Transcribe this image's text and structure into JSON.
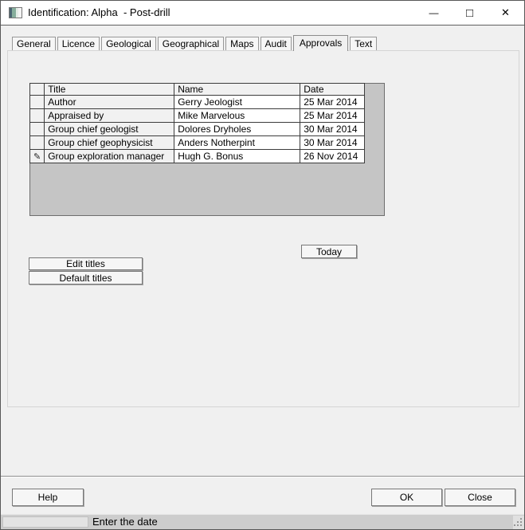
{
  "titlebar": {
    "title": "Identification: Alpha  - Post-drill",
    "icons": {
      "minimize": "—",
      "maximize": "□",
      "close": "✕"
    }
  },
  "tabs": {
    "selected": "Approvals",
    "items": [
      {
        "label": "General"
      },
      {
        "label": "Licence"
      },
      {
        "label": "Geological"
      },
      {
        "label": "Geographical"
      },
      {
        "label": "Maps"
      },
      {
        "label": "Audit"
      },
      {
        "label": "Approvals"
      },
      {
        "label": "Text"
      }
    ]
  },
  "approvals": {
    "table": {
      "columns": {
        "title": "Title",
        "name": "Name",
        "date": "Date"
      },
      "edit_pencil": "✎",
      "rows": [
        {
          "title": "Author",
          "name": "Gerry Jeologist",
          "date": "25 Mar 2014"
        },
        {
          "title": "Appraised by",
          "name": "Mike Marvelous",
          "date": "25 Mar 2014"
        },
        {
          "title": "Group chief geologist",
          "name": "Dolores Dryholes",
          "date": "30 Mar 2014"
        },
        {
          "title": "Group chief geophysicist",
          "name": "Anders Notherpint",
          "date": "30 Mar 2014"
        },
        {
          "title": "Group exploration manager",
          "name": "Hugh G. Bonus",
          "date": "26 Nov 2014"
        }
      ]
    },
    "buttons": {
      "today": "Today",
      "edit_titles": "Edit titles",
      "default_titles": "Default titles"
    }
  },
  "footer": {
    "help": "Help",
    "ok": "OK",
    "close": "Close"
  },
  "statusbar": {
    "message": "Enter the date"
  },
  "colors": {
    "dialog_bg": "#f0f0f0",
    "titlebar_bg": "#ffffff",
    "grid_area_bg": "#c5c5c5",
    "gridline": "#3c3c3c",
    "readonly_cell_bg": "#f1f1f1",
    "cell_bg": "#ffffff",
    "statusbar_bg": "#cdcdcd"
  }
}
